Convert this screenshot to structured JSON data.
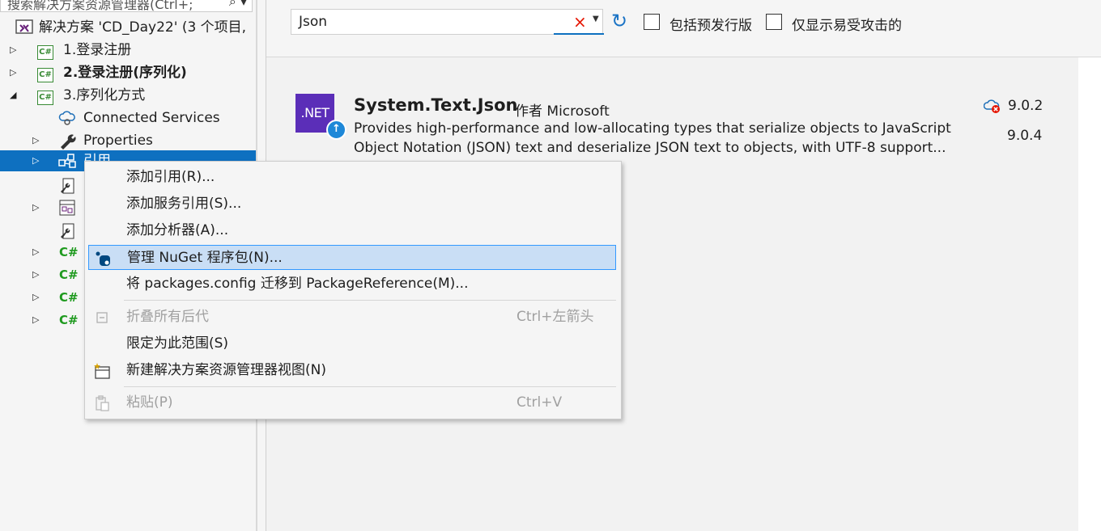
{
  "explorer": {
    "search_placeholder": "搜索解决方案资源管理器(Ctrl+;",
    "solution_label": "解决方案 'CD_Day22' (3 个项目,",
    "projects": [
      {
        "expander": "▷",
        "label": "1.登录注册"
      },
      {
        "expander": "▷",
        "label": "2.登录注册(序列化)"
      },
      {
        "expander": "◢",
        "label": "3.序列化方式"
      }
    ],
    "children": {
      "connected_services": "Connected Services",
      "properties": "Properties",
      "references": "引用"
    },
    "cs_icon_text": "C#",
    "cs_file_icon_text": "C#"
  },
  "nuget": {
    "search_value": "Json",
    "clear_icon": "×",
    "dropdown_icon": "▼",
    "refresh_icon": "↻",
    "prerelease_label": "包括预发行版",
    "vulnerable_label": "仅显示易受攻击的",
    "package": {
      "icon_text": ".NET",
      "update_icon": "↑",
      "name": "System.Text.Json",
      "author": "作者 Microsoft",
      "desc_line1": "Provides high-performance and low-allocating types that serialize objects to JavaScript",
      "desc_line2": "Object Notation (JSON) text and deserialize JSON text to objects, with UTF-8 support...",
      "installed_version": "9.0.2",
      "latest_version": "9.0.4"
    }
  },
  "context_menu": {
    "items": [
      {
        "label": "添加引用(R)..."
      },
      {
        "label": "添加服务引用(S)..."
      },
      {
        "label": "添加分析器(A)..."
      },
      {
        "label": "管理 NuGet 程序包(N)..."
      },
      {
        "label": "将 packages.config 迁移到 PackageReference(M)..."
      },
      {
        "label": "折叠所有后代",
        "shortcut": "Ctrl+左箭头"
      },
      {
        "label": "限定为此范围(S)"
      },
      {
        "label": "新建解决方案资源管理器视图(N)"
      },
      {
        "label": "粘贴(P)",
        "shortcut": "Ctrl+V"
      }
    ]
  }
}
